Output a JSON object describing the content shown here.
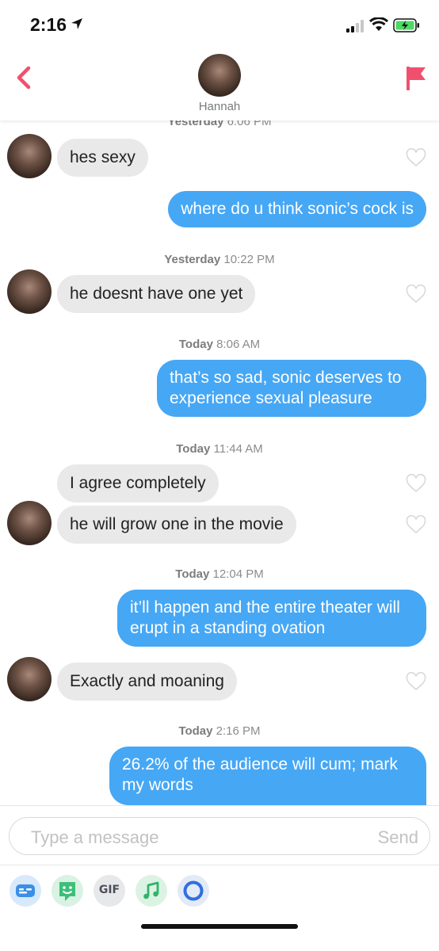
{
  "status_bar": {
    "time": "2:16"
  },
  "header": {
    "name": "Hannah",
    "icons": [
      "back-chevron-icon",
      "report-flag-icon"
    ],
    "accent": "#f0506e"
  },
  "messages": [
    {
      "type": "timestamp",
      "day": "Yesterday",
      "time": "6:06 PM"
    },
    {
      "type": "incoming",
      "text": "hes sexy"
    },
    {
      "type": "outgoing",
      "text": "where do u think sonic’s cock is"
    },
    {
      "type": "timestamp",
      "day": "Yesterday",
      "time": "10:22 PM"
    },
    {
      "type": "incoming",
      "text": "he doesnt have one yet"
    },
    {
      "type": "timestamp",
      "day": "Today",
      "time": "8:06 AM"
    },
    {
      "type": "outgoing",
      "text": "that’s so sad, sonic deserves to experience sexual pleasure"
    },
    {
      "type": "timestamp",
      "day": "Today",
      "time": "11:44 AM"
    },
    {
      "type": "incoming",
      "text": "I agree completely"
    },
    {
      "type": "incoming",
      "text": "he will grow one in the movie"
    },
    {
      "type": "timestamp",
      "day": "Today",
      "time": "12:04 PM"
    },
    {
      "type": "outgoing",
      "text": "it’ll happen and the entire theater will erupt in a standing ovation"
    },
    {
      "type": "incoming",
      "text": "Exactly and moaning"
    },
    {
      "type": "timestamp",
      "day": "Today",
      "time": "2:16 PM"
    },
    {
      "type": "outgoing",
      "text": "26.2% of the audience will cum; mark my words"
    }
  ],
  "composer": {
    "placeholder": "Type a message",
    "send_label": "Send",
    "tools": [
      {
        "name": "sticker-icon"
      },
      {
        "name": "bitmoji-icon"
      },
      {
        "name": "gif-button",
        "label": "GIF"
      },
      {
        "name": "music-icon"
      },
      {
        "name": "loops-icon"
      }
    ]
  },
  "colors": {
    "outgoing_bubble": "#46a7f5",
    "incoming_bubble": "#e9e9ea",
    "battery": "#4cd964"
  }
}
